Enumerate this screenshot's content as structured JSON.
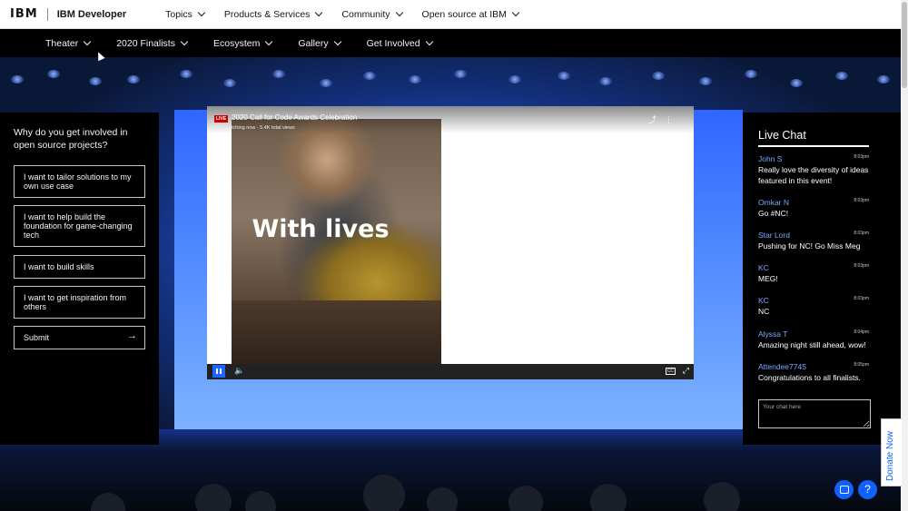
{
  "header": {
    "logo": "IBM",
    "brand": "IBM Developer",
    "nav": [
      {
        "label": "Topics"
      },
      {
        "label": "Products & Services"
      },
      {
        "label": "Community"
      },
      {
        "label": "Open source at IBM"
      }
    ]
  },
  "subnav": [
    {
      "label": "Theater"
    },
    {
      "label": "2020 Finalists"
    },
    {
      "label": "Ecosystem"
    },
    {
      "label": "Gallery"
    },
    {
      "label": "Get Involved"
    }
  ],
  "poll": {
    "question": "Why do you get involved in open source projects?",
    "options": [
      "I want to tailor solutions to my own use case",
      "I want to help build the foundation for game-changing tech",
      "I want to build skills",
      "I want to get inspiration from others"
    ],
    "submit_label": "Submit"
  },
  "video": {
    "live_badge": "LIVE",
    "title": "2020 Call for Code Awards Celebration",
    "subtitle": "tching now · 5.4K total views",
    "overlay_text": "With lives",
    "cc_label": "CC"
  },
  "chat": {
    "title": "Live Chat",
    "messages": [
      {
        "user": "John S",
        "time": "8:03pm",
        "text": "Really love the diversity of ideas featured in this event!"
      },
      {
        "user": "Omkar N",
        "time": "8:03pm",
        "text": "Go #NC!"
      },
      {
        "user": "Star Lord",
        "time": "8:03pm",
        "text": "Pushing for NC! Go Miss Meg"
      },
      {
        "user": "KC",
        "time": "8:03pm",
        "text": "MEG!"
      },
      {
        "user": "KC",
        "time": "8:03pm",
        "text": "NC"
      },
      {
        "user": "Alyssa T",
        "time": "8:04pm",
        "text": "Amazing night still ahead, wow!"
      },
      {
        "user": "Attendee7745",
        "time": "8:05pm",
        "text": "Congratulations to all finalists."
      }
    ],
    "input_placeholder": "Your chat here"
  },
  "donate_label": "Donate Now",
  "help_label": "?",
  "colors": {
    "accent": "#0f62fe",
    "link": "#78a9ff",
    "live": "#cc0000"
  }
}
